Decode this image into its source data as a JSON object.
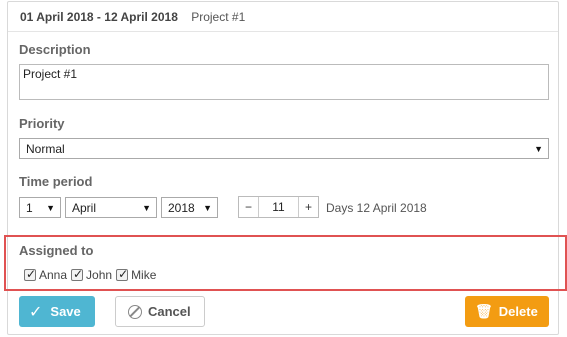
{
  "header": {
    "date_range": "01 April 2018 - 12 April 2018",
    "title": "Project #1"
  },
  "description": {
    "label": "Description",
    "value": "Project #1"
  },
  "priority": {
    "label": "Priority",
    "selected": "Normal"
  },
  "time_period": {
    "label": "Time period",
    "day": "1",
    "month": "April",
    "year": "2018",
    "duration": "11",
    "minus_label": "−",
    "plus_label": "+",
    "end_text": "Days 12 April 2018"
  },
  "assigned": {
    "label": "Assigned to",
    "people": [
      {
        "name": "Anna",
        "checked": true
      },
      {
        "name": "John",
        "checked": true
      },
      {
        "name": "Mike",
        "checked": true
      }
    ]
  },
  "buttons": {
    "save": "Save",
    "cancel": "Cancel",
    "delete": "Delete"
  },
  "colors": {
    "save": "#4fb6d2",
    "delete": "#f39c12",
    "highlight_border": "#e05252"
  }
}
